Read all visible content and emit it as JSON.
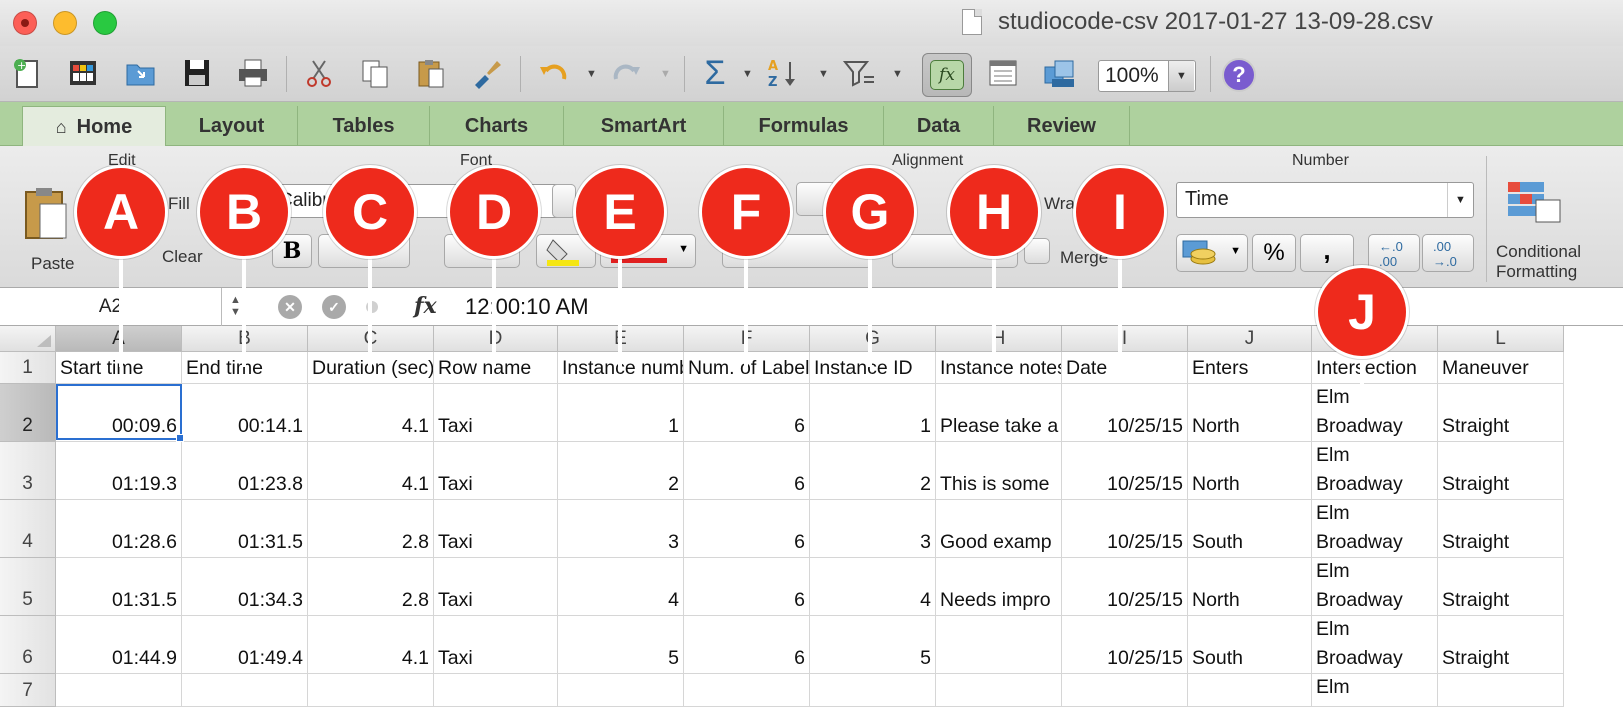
{
  "window": {
    "title": "studiocode-csv 2017-01-27 13-09-28.csv"
  },
  "toolbar": {
    "zoom": "100%"
  },
  "tabs": [
    "Home",
    "Layout",
    "Tables",
    "Charts",
    "SmartArt",
    "Formulas",
    "Data",
    "Review"
  ],
  "ribbon": {
    "groups": {
      "edit": "Edit",
      "font": "Font",
      "alignment": "Alignment",
      "number": "Number"
    },
    "paste": "Paste",
    "fill": "Fill",
    "clear": "Clear",
    "font_name": "Calibri",
    "bold": "B",
    "wrap_text": "Wrap",
    "merge": "Merge",
    "number_format": "Time",
    "percent": "%",
    "comma": ",",
    "conditional_formatting_line1": "Conditional",
    "conditional_formatting_line2": "Formatting"
  },
  "formula_bar": {
    "name_box": "A2",
    "fx": "fx",
    "value": "12:00:10 AM"
  },
  "columns": [
    "A",
    "B",
    "C",
    "D",
    "E",
    "F",
    "G",
    "H",
    "I",
    "J",
    "K",
    "L"
  ],
  "rows": [
    {
      "num": "1",
      "cells": [
        "Start time",
        "End time",
        "Duration (sec)",
        "Row name",
        "Instance number",
        "Num. of Labels",
        "Instance ID",
        "Instance notes",
        "Date",
        "Enters",
        "Intersection",
        "Maneuver"
      ]
    },
    {
      "num": "2",
      "cells": [
        "00:09.6",
        "00:14.1",
        "4.1",
        "Taxi",
        "1",
        "6",
        "1",
        "Please take a",
        "10/25/15",
        "North",
        "Elm\nBroadway",
        "Straight"
      ]
    },
    {
      "num": "3",
      "cells": [
        "01:19.3",
        "01:23.8",
        "4.1",
        "Taxi",
        "2",
        "6",
        "2",
        "This is some",
        "10/25/15",
        "North",
        "Elm\nBroadway",
        "Straight"
      ]
    },
    {
      "num": "4",
      "cells": [
        "01:28.6",
        "01:31.5",
        "2.8",
        "Taxi",
        "3",
        "6",
        "3",
        "Good examp",
        "10/25/15",
        "South",
        "Elm\nBroadway",
        "Straight"
      ]
    },
    {
      "num": "5",
      "cells": [
        "01:31.5",
        "01:34.3",
        "2.8",
        "Taxi",
        "4",
        "6",
        "4",
        "Needs impro",
        "10/25/15",
        "North",
        "Elm\nBroadway",
        "Straight"
      ]
    },
    {
      "num": "6",
      "cells": [
        "01:44.9",
        "01:49.4",
        "4.1",
        "Taxi",
        "5",
        "6",
        "5",
        "",
        "10/25/15",
        "South",
        "Elm\nBroadway",
        "Straight"
      ]
    },
    {
      "num": "7",
      "cells": [
        "",
        "",
        "",
        "",
        "",
        "",
        "",
        "",
        "",
        "",
        "Elm",
        ""
      ]
    }
  ],
  "callouts": [
    "A",
    "B",
    "C",
    "D",
    "E",
    "F",
    "G",
    "H",
    "I",
    "J"
  ]
}
